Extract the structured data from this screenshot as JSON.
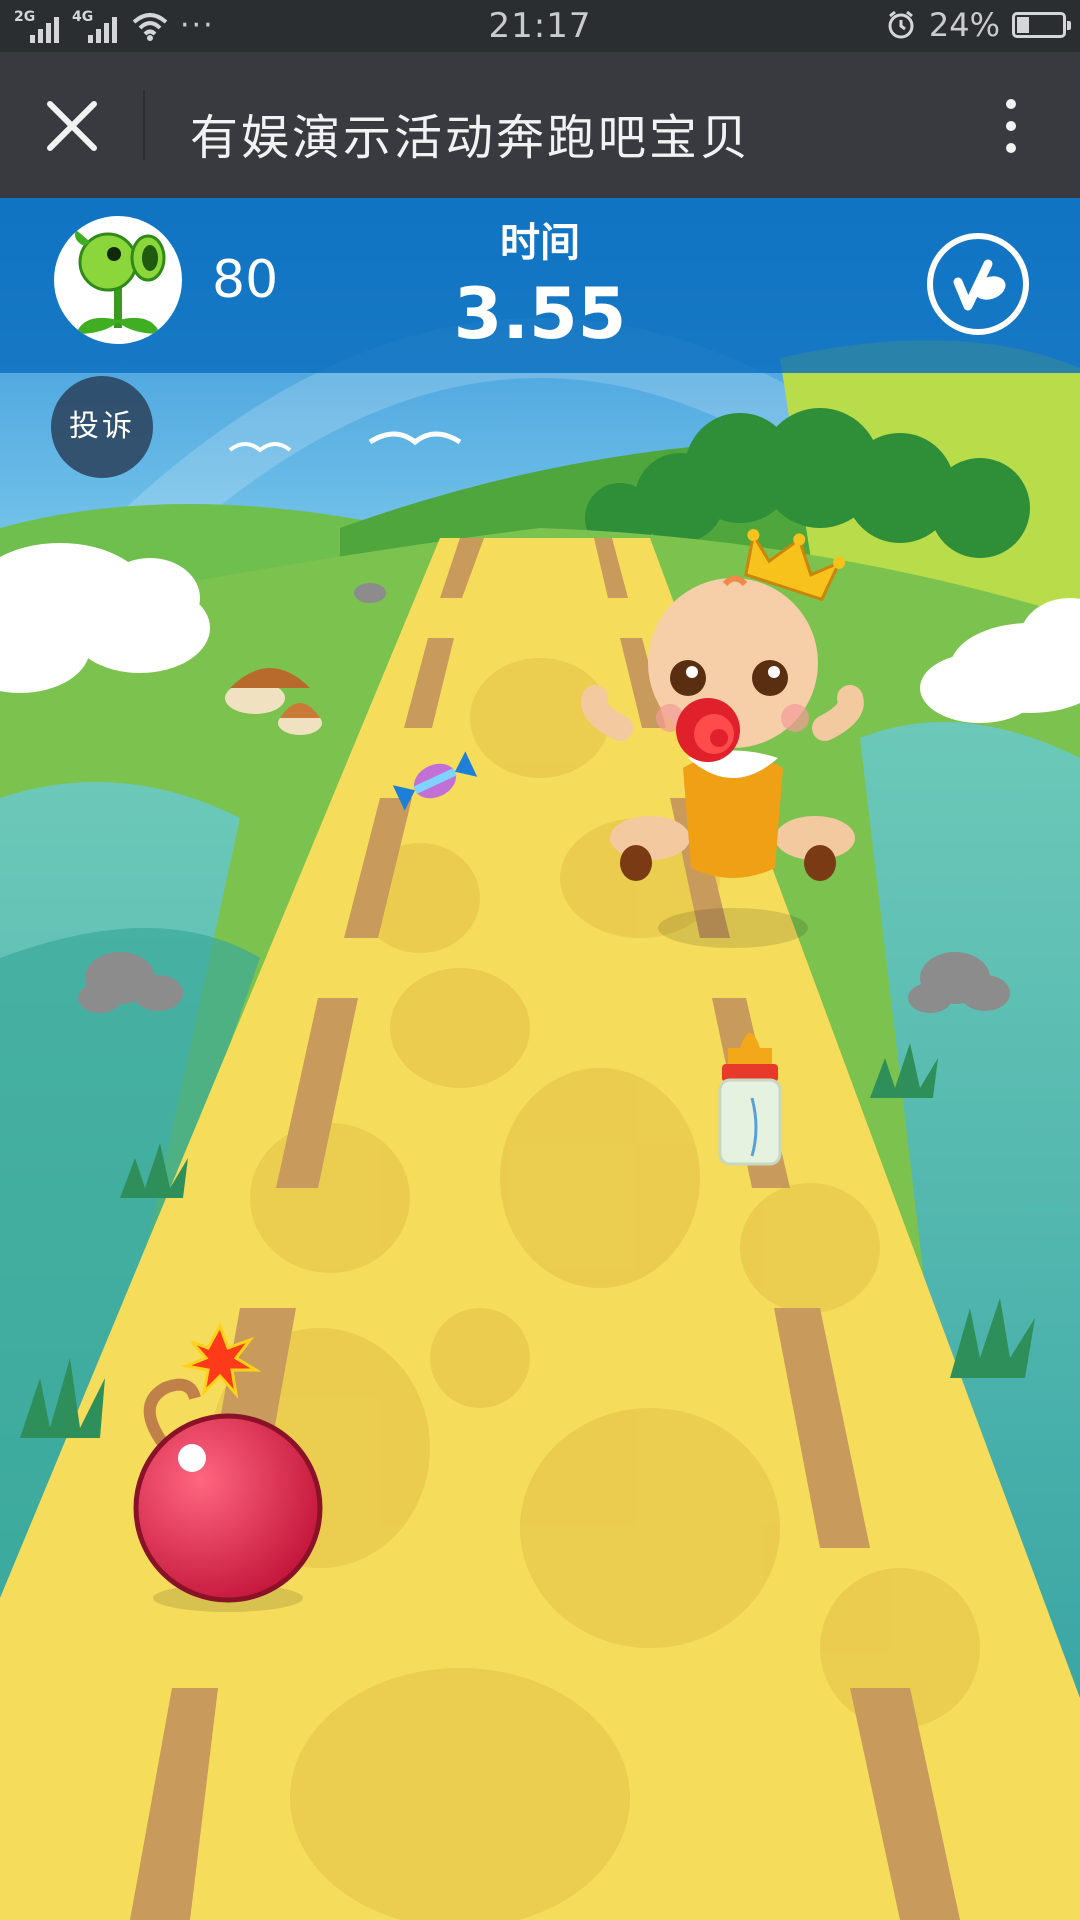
{
  "status_bar": {
    "network_1": "2G",
    "network_2": "4G",
    "more_indicator": "···",
    "time": "21:17",
    "battery_level": "24%",
    "icons": [
      "signal-icon",
      "wifi-icon",
      "alarm-icon",
      "battery-icon"
    ]
  },
  "navbar": {
    "title": "有娱演示活动奔跑吧宝贝",
    "icons": [
      "close-icon",
      "more-vertical-icon"
    ]
  },
  "hud": {
    "score": "80",
    "time_label": "时间",
    "time_value": "3.55",
    "icons": [
      "plant-avatar-icon",
      "music-note-icon"
    ]
  },
  "complaint_button": {
    "label": "投诉"
  },
  "colors": {
    "status_bar": "#2b2e31",
    "navbar": "#393a3f",
    "hud": "#1a7fc6",
    "road": "#f5dc5a",
    "grass": "#6ac05a",
    "water": "#4db8a8",
    "bomb": "#d8264a"
  }
}
